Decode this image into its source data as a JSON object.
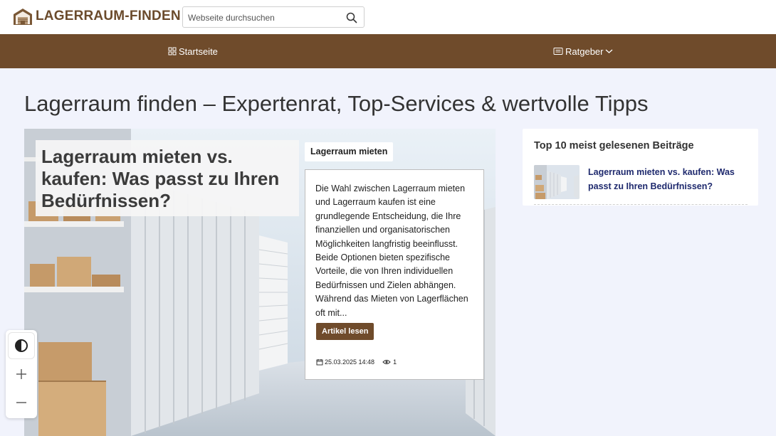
{
  "header": {
    "logo_text": "LAGERRAUM-FINDEN",
    "search_placeholder": "Webseite durchsuchen",
    "search_icon": "search-icon"
  },
  "nav": {
    "home_label": "Startseite",
    "home_icon": "grid-icon",
    "guide_label": "Ratgeber",
    "guide_icon": "article-icon",
    "guide_chevron": "chevron-down-icon"
  },
  "page": {
    "title": "Lagerraum finden – Expertenrat, Top-Services & wertvolle Tipps"
  },
  "hero": {
    "title": "Lagerraum mieten vs. kaufen: Was passt zu Ihren Bedürfnissen?",
    "category": "Lagerraum mieten",
    "excerpt": "Die Wahl zwischen Lagerraum mieten und Lagerraum kaufen ist eine grundlegende Entscheidung, die Ihre finanziellen und organisatorischen Möglichkeiten langfristig beeinflusst. Beide Optionen bieten spezifische Vorteile, die von Ihren individuellen Bedürfnissen und Zielen abhängen. Während das Mieten von Lagerflächen oft mit...",
    "read_more": "Artikel lesen",
    "date": "25.03.2025 14:48",
    "views": "1"
  },
  "sidebar": {
    "title": "Top 10 meist gelesenen Beiträge",
    "items": [
      {
        "title": "Lagerraum mieten vs. kaufen: Was passt zu Ihren Bedürfnissen?"
      }
    ]
  },
  "accessibility": {
    "contrast_icon": "contrast-icon",
    "zoom_in_icon": "plus-icon",
    "zoom_out_icon": "minus-icon"
  },
  "colors": {
    "brand_brown": "#6f4b2b",
    "page_bg": "#f1f3fc",
    "link_navy": "#1f2a6e"
  }
}
